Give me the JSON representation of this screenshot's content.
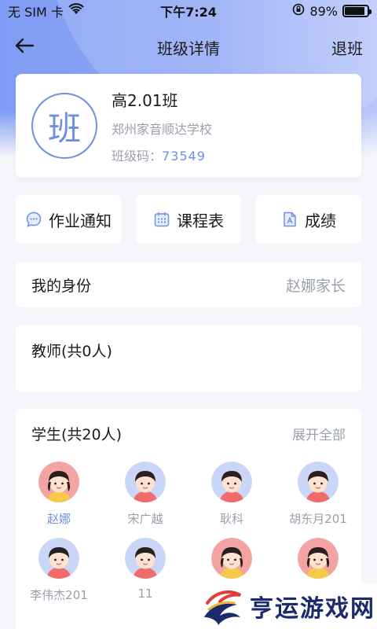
{
  "status_bar": {
    "carrier": "无 SIM 卡",
    "time": "下午7:24",
    "battery_percent": "89%",
    "battery_level": 0.89
  },
  "nav": {
    "back_icon": "arrow-left-icon",
    "title": "班级详情",
    "action": "退班"
  },
  "class_card": {
    "avatar_char": "班",
    "name": "高2.01班",
    "school": "郑州家音顺达学校",
    "code_label": "班级码：",
    "code_value": "73549"
  },
  "actions": [
    {
      "label": "作业通知",
      "icon": "chat-bubble-icon"
    },
    {
      "label": "课程表",
      "icon": "calendar-icon"
    },
    {
      "label": "成绩",
      "icon": "document-icon"
    }
  ],
  "identity": {
    "label": "我的身份",
    "value": "赵娜家长"
  },
  "teachers": {
    "title": "教师(共0人)"
  },
  "students": {
    "title": "学生(共20人)",
    "expand": "展开全部",
    "list": [
      {
        "name": "赵娜",
        "gender": "female",
        "active": true
      },
      {
        "name": "宋广越",
        "gender": "male",
        "active": false
      },
      {
        "name": "耿科",
        "gender": "male",
        "active": false
      },
      {
        "name": "胡东月201",
        "gender": "male",
        "active": false
      },
      {
        "name": "李伟杰201",
        "gender": "male",
        "active": false
      },
      {
        "name": "11",
        "gender": "male",
        "active": false
      },
      {
        "name": "",
        "gender": "female",
        "active": false
      },
      {
        "name": "",
        "gender": "female",
        "active": false
      }
    ]
  },
  "watermark": {
    "text": "亨运游戏网"
  },
  "colors": {
    "accent": "#6f8fe0",
    "header_start": "#7f9cf4",
    "header_end": "#b8c6fb",
    "muted_text": "#9aa0ab",
    "female_avatar_bg": "#f4a3a3",
    "male_avatar_bg": "#c9d6f7"
  }
}
